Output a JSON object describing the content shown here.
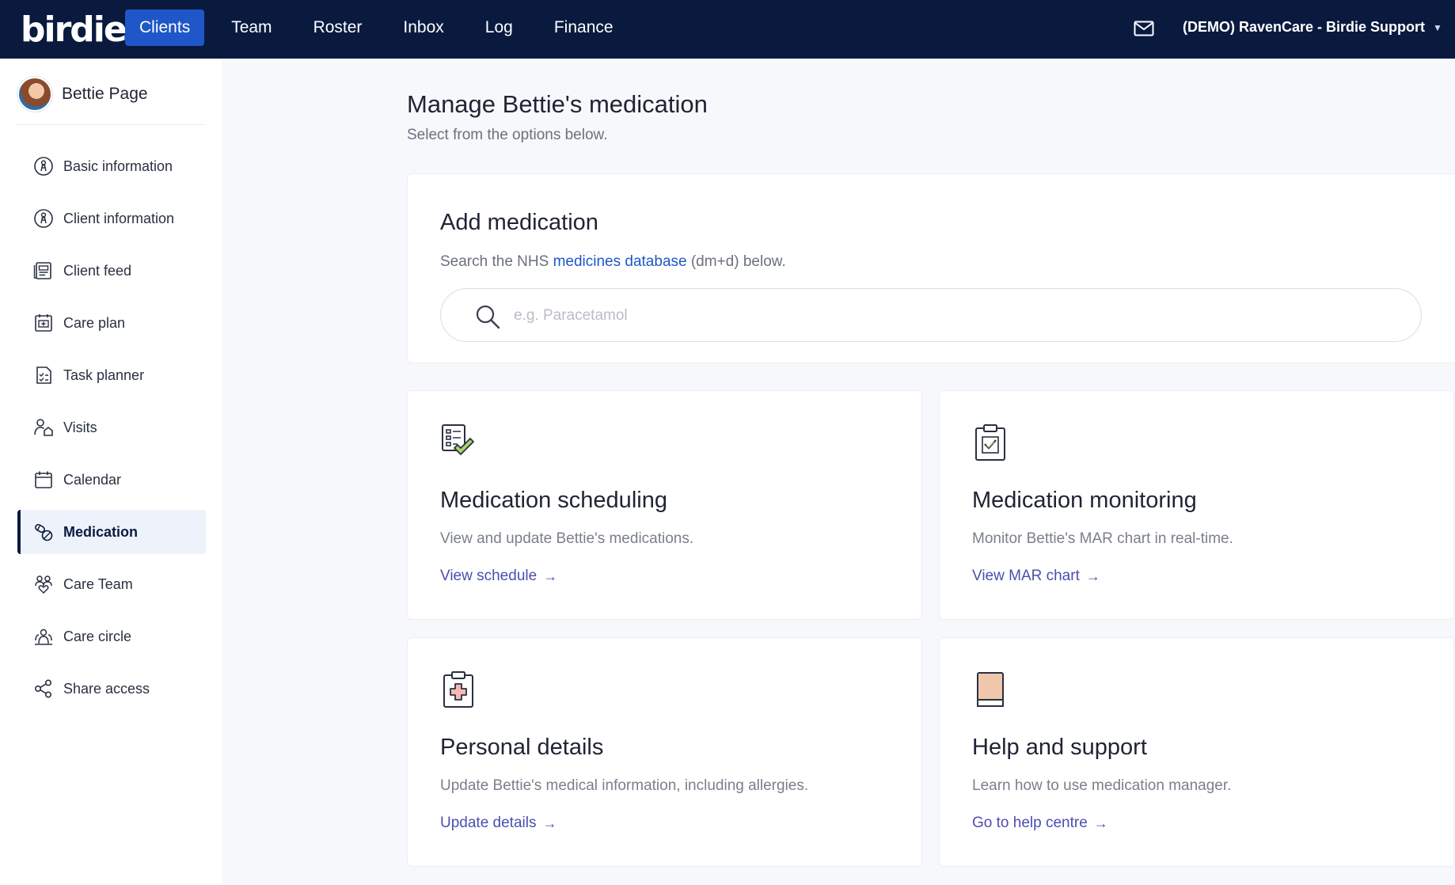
{
  "topbar": {
    "logo": "birdie",
    "nav": [
      {
        "label": "Clients"
      },
      {
        "label": "Team"
      },
      {
        "label": "Roster"
      },
      {
        "label": "Inbox"
      },
      {
        "label": "Log"
      },
      {
        "label": "Finance"
      }
    ],
    "active_nav": "Clients",
    "account_label": "(DEMO) RavenCare - Birdie Support",
    "mail_icon": "mail-icon"
  },
  "sidebar": {
    "client_name": "Bettie Page",
    "items": [
      {
        "label": "Basic information",
        "icon": "person-circle-icon"
      },
      {
        "label": "Client information",
        "icon": "person-circle-icon"
      },
      {
        "label": "Client feed",
        "icon": "feed-icon"
      },
      {
        "label": "Care plan",
        "icon": "care-plan-icon"
      },
      {
        "label": "Task planner",
        "icon": "task-planner-icon"
      },
      {
        "label": "Visits",
        "icon": "visits-icon"
      },
      {
        "label": "Calendar",
        "icon": "calendar-icon"
      },
      {
        "label": "Medication",
        "icon": "pill-icon"
      },
      {
        "label": "Care Team",
        "icon": "care-team-icon"
      },
      {
        "label": "Care circle",
        "icon": "care-circle-icon"
      },
      {
        "label": "Share access",
        "icon": "share-icon"
      }
    ],
    "active_item": "Medication"
  },
  "main": {
    "title": "Manage Bettie's medication",
    "subtitle": "Select from the options below.",
    "add": {
      "title": "Add medication",
      "desc_prefix": "Search the NHS ",
      "desc_link": "medicines database",
      "desc_suffix": " (dm+d) below.",
      "search_placeholder": "e.g. Paracetamol"
    },
    "tiles": [
      {
        "title": "Medication scheduling",
        "desc": "View and update Bettie's medications.",
        "link": "View schedule"
      },
      {
        "title": "Medication monitoring",
        "desc": "Monitor Bettie's MAR chart in real-time.",
        "link": "View MAR chart"
      },
      {
        "title": "Personal details",
        "desc": "Update Bettie's medical information, including allergies.",
        "link": "Update details"
      },
      {
        "title": "Help and support",
        "desc": "Learn how to use medication manager.",
        "link": "Go to help centre"
      }
    ]
  },
  "colors": {
    "topbar": "#0a1a3f",
    "active_nav": "#1f57c8",
    "link": "#1f57c8",
    "tile_link": "#4a4fb0",
    "accent_check": "#8cc63f"
  }
}
